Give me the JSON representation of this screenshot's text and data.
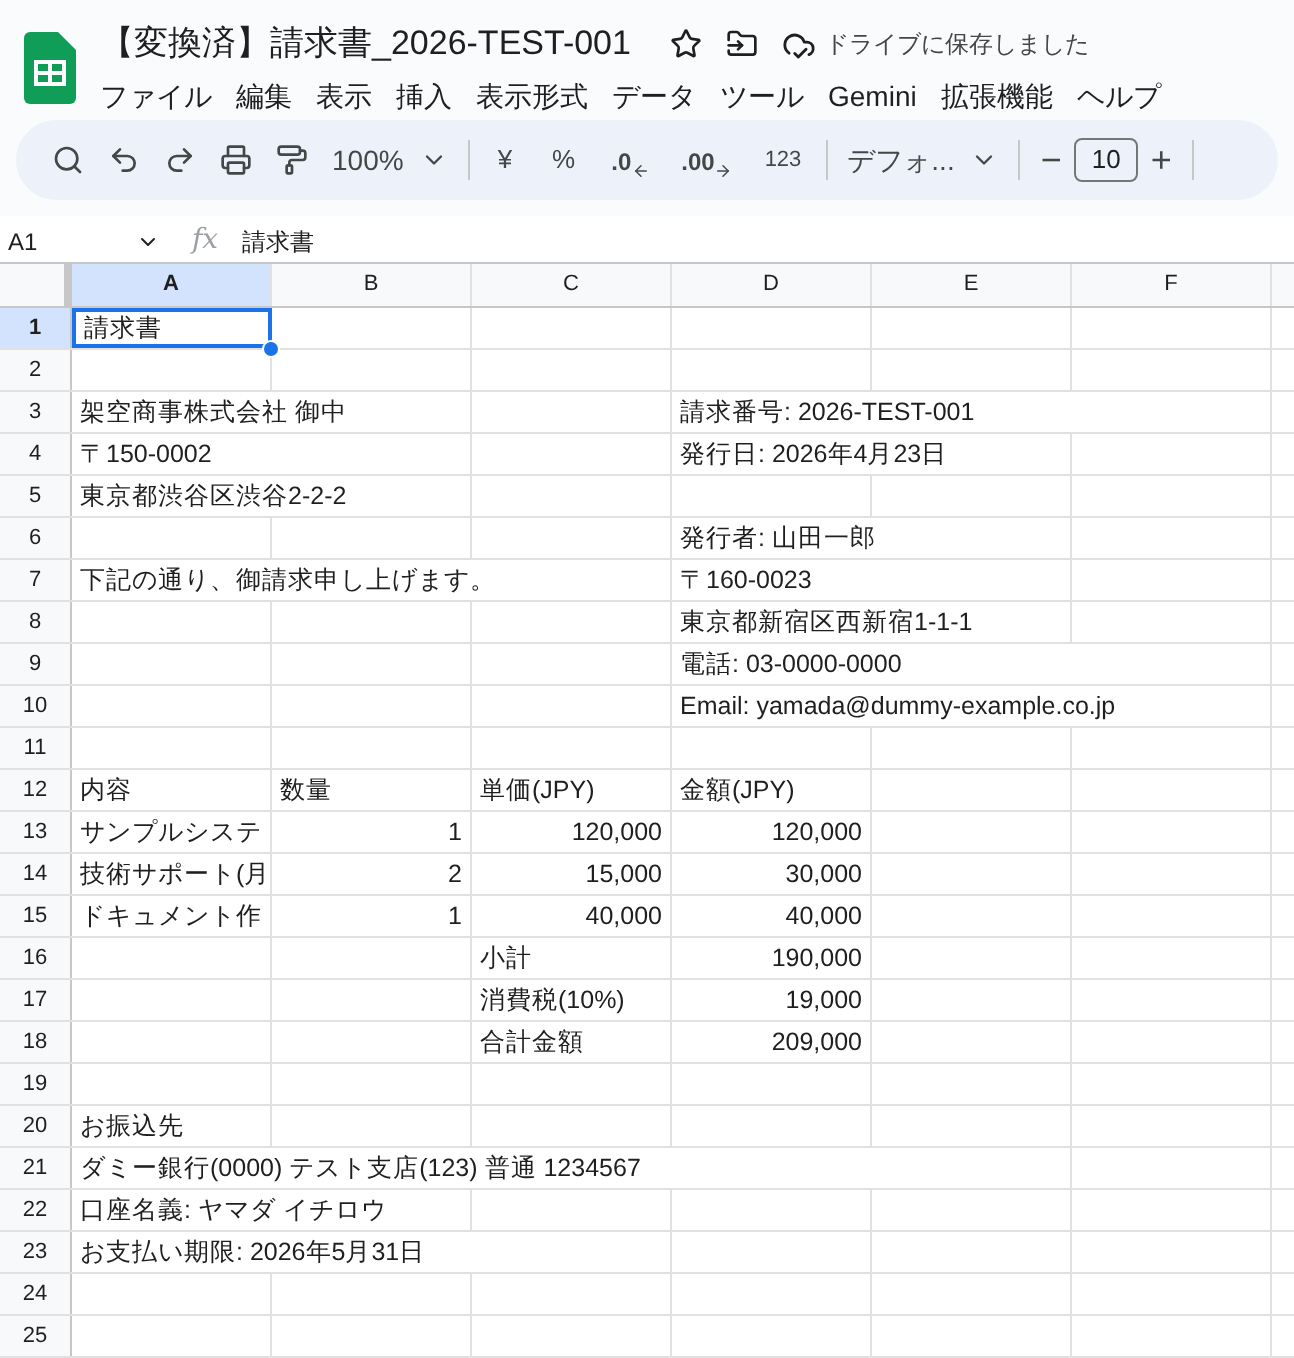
{
  "document": {
    "title": "【変換済】請求書_2026-TEST-001",
    "save_status": "ドライブに保存しました"
  },
  "menu": [
    "ファイル",
    "編集",
    "表示",
    "挿入",
    "表示形式",
    "データ",
    "ツール",
    "Gemini",
    "拡張機能",
    "ヘルプ"
  ],
  "toolbar": {
    "zoom": "100%",
    "currency": "¥",
    "percent": "%",
    "decrease_decimal": ".0",
    "increase_decimal": ".00",
    "number_format": "123",
    "font": "デフォ...",
    "font_size": "10",
    "minus": "−",
    "plus": "+"
  },
  "formula_bar": {
    "cell_ref": "A1",
    "function_label": "fx",
    "formula": "請求書"
  },
  "columns": [
    {
      "label": "A",
      "selected": true
    },
    {
      "label": "B",
      "selected": false
    },
    {
      "label": "C",
      "selected": false
    },
    {
      "label": "D",
      "selected": false
    },
    {
      "label": "E",
      "selected": false
    },
    {
      "label": "F",
      "selected": false
    }
  ],
  "rows": [
    {
      "number": "1",
      "selected": true,
      "cells": {
        "A": {
          "kind": "text",
          "value": "請求書",
          "selected": true
        }
      }
    },
    {
      "number": "2",
      "selected": false,
      "cells": {}
    },
    {
      "number": "3",
      "selected": false,
      "cells": {
        "A": {
          "kind": "text",
          "value": "架空商事株式会社 御中",
          "selected": false
        },
        "D": {
          "kind": "text",
          "value": "請求番号: 2026-TEST-001",
          "selected": false
        }
      }
    },
    {
      "number": "4",
      "selected": false,
      "cells": {
        "A": {
          "kind": "text",
          "value": "〒150-0002",
          "selected": false
        },
        "D": {
          "kind": "text",
          "value": "発行日: 2026年4月23日",
          "selected": false
        }
      }
    },
    {
      "number": "5",
      "selected": false,
      "cells": {
        "A": {
          "kind": "text",
          "value": "東京都渋谷区渋谷2-2-2",
          "selected": false
        }
      }
    },
    {
      "number": "6",
      "selected": false,
      "cells": {
        "D": {
          "kind": "text",
          "value": "発行者: 山田一郎",
          "selected": false
        }
      }
    },
    {
      "number": "7",
      "selected": false,
      "cells": {
        "A": {
          "kind": "text",
          "value": "下記の通り、御請求申し上げます。",
          "selected": false
        },
        "D": {
          "kind": "text",
          "value": "〒160-0023",
          "selected": false
        }
      }
    },
    {
      "number": "8",
      "selected": false,
      "cells": {
        "D": {
          "kind": "text",
          "value": "東京都新宿区西新宿1-1-1",
          "selected": false
        }
      }
    },
    {
      "number": "9",
      "selected": false,
      "cells": {
        "D": {
          "kind": "text",
          "value": "電話: 03-0000-0000",
          "selected": false
        }
      }
    },
    {
      "number": "10",
      "selected": false,
      "cells": {
        "D": {
          "kind": "text",
          "value": "Email: yamada@dummy-example.co.jp",
          "selected": false
        }
      }
    },
    {
      "number": "11",
      "selected": false,
      "cells": {}
    },
    {
      "number": "12",
      "selected": false,
      "cells": {
        "A": {
          "kind": "text",
          "value": "内容",
          "selected": false
        },
        "B": {
          "kind": "text",
          "value": "数量",
          "selected": false
        },
        "C": {
          "kind": "text",
          "value": "単価(JPY)",
          "selected": false
        },
        "D": {
          "kind": "text",
          "value": "金額(JPY)",
          "selected": false
        }
      }
    },
    {
      "number": "13",
      "selected": false,
      "cells": {
        "A": {
          "kind": "text",
          "value": "サンプルシステ",
          "selected": false
        },
        "B": {
          "kind": "number",
          "value": "1",
          "selected": false
        },
        "C": {
          "kind": "number",
          "value": "120,000",
          "selected": false
        },
        "D": {
          "kind": "number",
          "value": "120,000",
          "selected": false
        }
      }
    },
    {
      "number": "14",
      "selected": false,
      "cells": {
        "A": {
          "kind": "text",
          "value": "技術サポート(月",
          "selected": false
        },
        "B": {
          "kind": "number",
          "value": "2",
          "selected": false
        },
        "C": {
          "kind": "number",
          "value": "15,000",
          "selected": false
        },
        "D": {
          "kind": "number",
          "value": "30,000",
          "selected": false
        }
      }
    },
    {
      "number": "15",
      "selected": false,
      "cells": {
        "A": {
          "kind": "text",
          "value": "ドキュメント作",
          "selected": false
        },
        "B": {
          "kind": "number",
          "value": "1",
          "selected": false
        },
        "C": {
          "kind": "number",
          "value": "40,000",
          "selected": false
        },
        "D": {
          "kind": "number",
          "value": "40,000",
          "selected": false
        }
      }
    },
    {
      "number": "16",
      "selected": false,
      "cells": {
        "C": {
          "kind": "text",
          "value": "小計",
          "selected": false
        },
        "D": {
          "kind": "number",
          "value": "190,000",
          "selected": false
        }
      }
    },
    {
      "number": "17",
      "selected": false,
      "cells": {
        "C": {
          "kind": "text",
          "value": "消費税(10%)",
          "selected": false
        },
        "D": {
          "kind": "number",
          "value": "19,000",
          "selected": false
        }
      }
    },
    {
      "number": "18",
      "selected": false,
      "cells": {
        "C": {
          "kind": "text",
          "value": "合計金額",
          "selected": false
        },
        "D": {
          "kind": "number",
          "value": "209,000",
          "selected": false
        }
      }
    },
    {
      "number": "19",
      "selected": false,
      "cells": {}
    },
    {
      "number": "20",
      "selected": false,
      "cells": {
        "A": {
          "kind": "text",
          "value": "お振込先",
          "selected": false
        }
      }
    },
    {
      "number": "21",
      "selected": false,
      "cells": {
        "A": {
          "kind": "text",
          "value": "ダミー銀行(0000) テスト支店(123) 普通 1234567",
          "selected": false
        }
      }
    },
    {
      "number": "22",
      "selected": false,
      "cells": {
        "A": {
          "kind": "text",
          "value": "口座名義: ヤマダ イチロウ",
          "selected": false
        }
      }
    },
    {
      "number": "23",
      "selected": false,
      "cells": {
        "A": {
          "kind": "text",
          "value": "お支払い期限: 2026年5月31日",
          "selected": false
        }
      }
    },
    {
      "number": "24",
      "selected": false,
      "cells": {}
    },
    {
      "number": "25",
      "selected": false,
      "cells": {}
    }
  ]
}
